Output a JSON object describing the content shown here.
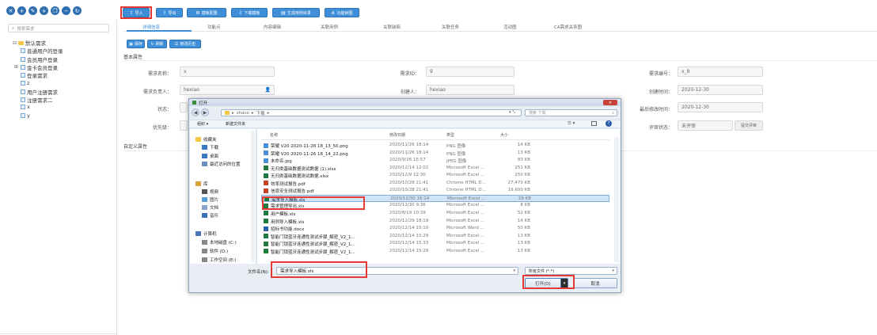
{
  "toolbar": {
    "buttons": [
      {
        "label": "导入",
        "icon": "import-icon"
      },
      {
        "label": "导出",
        "icon": "export-icon"
      },
      {
        "label": "模板配置",
        "icon": "gear-icon"
      },
      {
        "label": "下载模板",
        "icon": "download-icon"
      },
      {
        "label": "生成用例目录",
        "icon": "generate-icon"
      },
      {
        "label": "功能树图",
        "icon": "tree-icon"
      }
    ]
  },
  "sidebar": {
    "search_placeholder": "搜索需求",
    "tree": [
      {
        "label": "默认需求",
        "level": 0
      },
      {
        "label": "普通用户的登录",
        "level": 1
      },
      {
        "label": "会员用户登录",
        "level": 1
      },
      {
        "label": "金卡会员登录",
        "level": 1
      },
      {
        "label": "登录需求",
        "level": 1
      },
      {
        "label": "z",
        "level": 1
      },
      {
        "label": "用户注册需求",
        "level": 1
      },
      {
        "label": "注册需求二",
        "level": 1
      },
      {
        "label": "x",
        "level": 1
      },
      {
        "label": "y",
        "level": 1
      }
    ]
  },
  "tabs": [
    "详细信息",
    "功能点",
    "内容编辑",
    "关联用例",
    "关联缺陷",
    "关联任务",
    "活动图",
    "CA需求关系图"
  ],
  "actions": [
    "保存",
    "刷新",
    "修改历史"
  ],
  "section_basic": "基本属性",
  "section_custom": "自定义属性",
  "form": {
    "name_label": "需求名称：",
    "name_value": "x",
    "id_label": "需求ID：",
    "id_value": "9",
    "code_label": "需求编号：",
    "code_value": "x_9",
    "owner_label": "需求负责人：",
    "owner_value": "hexiao",
    "creator_label": "创建人：",
    "creator_value": "hexiao",
    "created_label": "创建时间：",
    "created_value": "2020-12-30",
    "status_label": "状态：",
    "modified_label": "最后修改时间：",
    "modified_value": "2020-12-30",
    "priority_label": "优先级：",
    "review_label": "评审状态：",
    "review_value": "未评审",
    "review_button": "提交评审"
  },
  "dialog": {
    "title": "打开",
    "path": [
      "shaco",
      "下载"
    ],
    "search_placeholder": "搜索 下载",
    "organize": "组织 ▾",
    "new_folder": "新建文件夹",
    "nav": [
      {
        "label": "收藏夹",
        "icon": "star-icon"
      },
      {
        "label": "下载",
        "icon": "download-folder-icon"
      },
      {
        "label": "桌面",
        "icon": "desktop-icon"
      },
      {
        "label": "最近访问的位置",
        "icon": "recent-icon"
      },
      {
        "label": "库",
        "icon": "library-icon"
      },
      {
        "label": "视频",
        "icon": "video-icon"
      },
      {
        "label": "图片",
        "icon": "picture-icon"
      },
      {
        "label": "文档",
        "icon": "document-icon"
      },
      {
        "label": "音乐",
        "icon": "music-icon"
      },
      {
        "label": "计算机",
        "icon": "computer-icon"
      },
      {
        "label": "本地磁盘 (C:)",
        "icon": "drive-icon"
      },
      {
        "label": "软件 (D:)",
        "icon": "drive-icon"
      },
      {
        "label": "工作空间 (E:)",
        "icon": "drive-icon"
      }
    ],
    "columns": [
      "名称",
      "修改日期",
      "类型",
      "大小"
    ],
    "files": [
      {
        "name": "荣耀 V20 2020-11-26 18_13_50.png",
        "date": "2020/11/26 18:14",
        "type": "PNG 图像",
        "size": "14 KB",
        "icon": "image-icon"
      },
      {
        "name": "荣耀 V20 2020-11-26 18_14_22.png",
        "date": "2020/11/26 18:14",
        "type": "PNG 图像",
        "size": "13 KB",
        "icon": "image-icon"
      },
      {
        "name": "未命名.jpg",
        "date": "2020/9/26 15:57",
        "type": "JPEG 图像",
        "size": "83 KB",
        "icon": "image-icon"
      },
      {
        "name": "无归类基础数据测试数据 (1).xlsx",
        "date": "2020/12/14 12:02",
        "type": "Microsoft Excel ...",
        "size": "251 KB",
        "icon": "excel-icon"
      },
      {
        "name": "无归类基础数据测试数据.xlsx",
        "date": "2020/12/9 12:30",
        "type": "Microsoft Excel ...",
        "size": "250 KB",
        "icon": "excel-icon"
      },
      {
        "name": "效率测试报告.pdf",
        "date": "2020/10/28 21:41",
        "type": "Chrome HTML D...",
        "size": "27,470 KB",
        "icon": "pdf-icon"
      },
      {
        "name": "信息安全测试报告.pdf",
        "date": "2020/10/28 21:41",
        "type": "Chrome HTML D...",
        "size": "19,600 KB",
        "icon": "pdf-icon"
      },
      {
        "name": "需求导入模板.xls",
        "date": "2020/12/30 16:14",
        "type": "Microsoft Excel ...",
        "size": "29 KB",
        "icon": "excel-icon",
        "selected": true
      },
      {
        "name": "需求管理导出.xls",
        "date": "2020/12/30 9:36",
        "type": "Microsoft Excel ...",
        "size": "8 KB",
        "icon": "excel-icon"
      },
      {
        "name": "用户模板.xls",
        "date": "2020/8/19 10:39",
        "type": "Microsoft Excel ...",
        "size": "52 KB",
        "icon": "excel-icon"
      },
      {
        "name": "用例导入模板.xls",
        "date": "2020/12/29 18:19",
        "type": "Microsoft Excel ...",
        "size": "14 KB",
        "icon": "excel-icon"
      },
      {
        "name": "招标书功能.docx",
        "date": "2020/12/14 15:10",
        "type": "Microsoft Word ...",
        "size": "50 KB",
        "icon": "word-icon"
      },
      {
        "name": "智能门锁蓝牙连通性测试步骤_解密_V2_1...",
        "date": "2020/12/14 15:29",
        "type": "Microsoft Excel ...",
        "size": "13 KB",
        "icon": "excel-icon"
      },
      {
        "name": "智能门锁蓝牙连通性测试步骤_解密_V2_1...",
        "date": "2020/12/14 15:33",
        "type": "Microsoft Excel ...",
        "size": "13 KB",
        "icon": "excel-icon"
      },
      {
        "name": "智能门锁蓝牙连通性测试步骤_解密_V2_1...",
        "date": "2020/12/14 15:29",
        "type": "Microsoft Excel ...",
        "size": "13 KB",
        "icon": "excel-icon"
      }
    ],
    "filename_label": "文件名(N):",
    "filename_value": "需求导入模板.xls",
    "filetype_value": "所有文件 (*.*)",
    "open_label": "打开(O)",
    "cancel_label": "取消"
  }
}
